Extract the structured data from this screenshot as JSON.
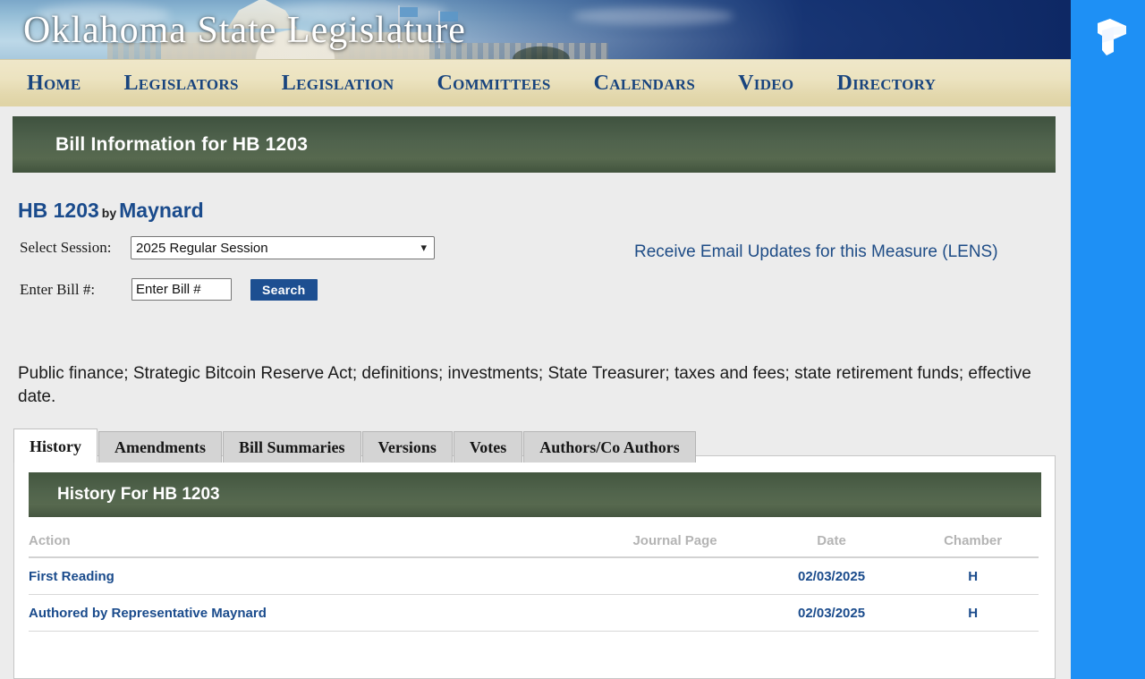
{
  "site": {
    "banner_title": "Oklahoma State Legislature",
    "logo_icon": "tulip-t-logo-icon"
  },
  "nav": {
    "items": [
      {
        "label": "Home"
      },
      {
        "label": "Legislators"
      },
      {
        "label": "Legislation"
      },
      {
        "label": "Committees"
      },
      {
        "label": "Calendars"
      },
      {
        "label": "Video"
      },
      {
        "label": "Directory"
      }
    ]
  },
  "page": {
    "title": "Bill Information for HB 1203"
  },
  "bill": {
    "number": "HB 1203",
    "by_word": "by",
    "author": "Maynard",
    "description": "Public finance; Strategic Bitcoin Reserve Act; definitions; investments; State Treasurer; taxes and fees; state retirement funds; effective date."
  },
  "form": {
    "session_label": "Select Session:",
    "session_value": "2025 Regular Session",
    "session_options": [
      "2025 Regular Session"
    ],
    "session_chevron_icon": "chevron-down-icon",
    "bill_label": "Enter Bill #:",
    "bill_placeholder": "Enter Bill #",
    "bill_value": "",
    "search_label": "Search"
  },
  "lens": {
    "label": "Receive Email Updates for this Measure (LENS)"
  },
  "tabs": [
    {
      "label": "History",
      "active": true
    },
    {
      "label": "Amendments",
      "active": false
    },
    {
      "label": "Bill Summaries",
      "active": false
    },
    {
      "label": "Versions",
      "active": false
    },
    {
      "label": "Votes",
      "active": false
    },
    {
      "label": "Authors/Co Authors",
      "active": false
    }
  ],
  "history": {
    "title": "History For HB 1203",
    "columns": [
      "Action",
      "Journal Page",
      "Date",
      "Chamber"
    ],
    "rows": [
      {
        "action": "First Reading",
        "journal_page": "",
        "date": "02/03/2025",
        "chamber": "H"
      },
      {
        "action": "Authored by Representative Maynard",
        "journal_page": "",
        "date": "02/03/2025",
        "chamber": "H"
      }
    ]
  },
  "colors": {
    "nav_text": "#18447e",
    "green_bar": "#50634d",
    "link_blue": "#1e4c86",
    "accent_blue": "#1d4f91",
    "panel_blue": "#1e90f5"
  }
}
